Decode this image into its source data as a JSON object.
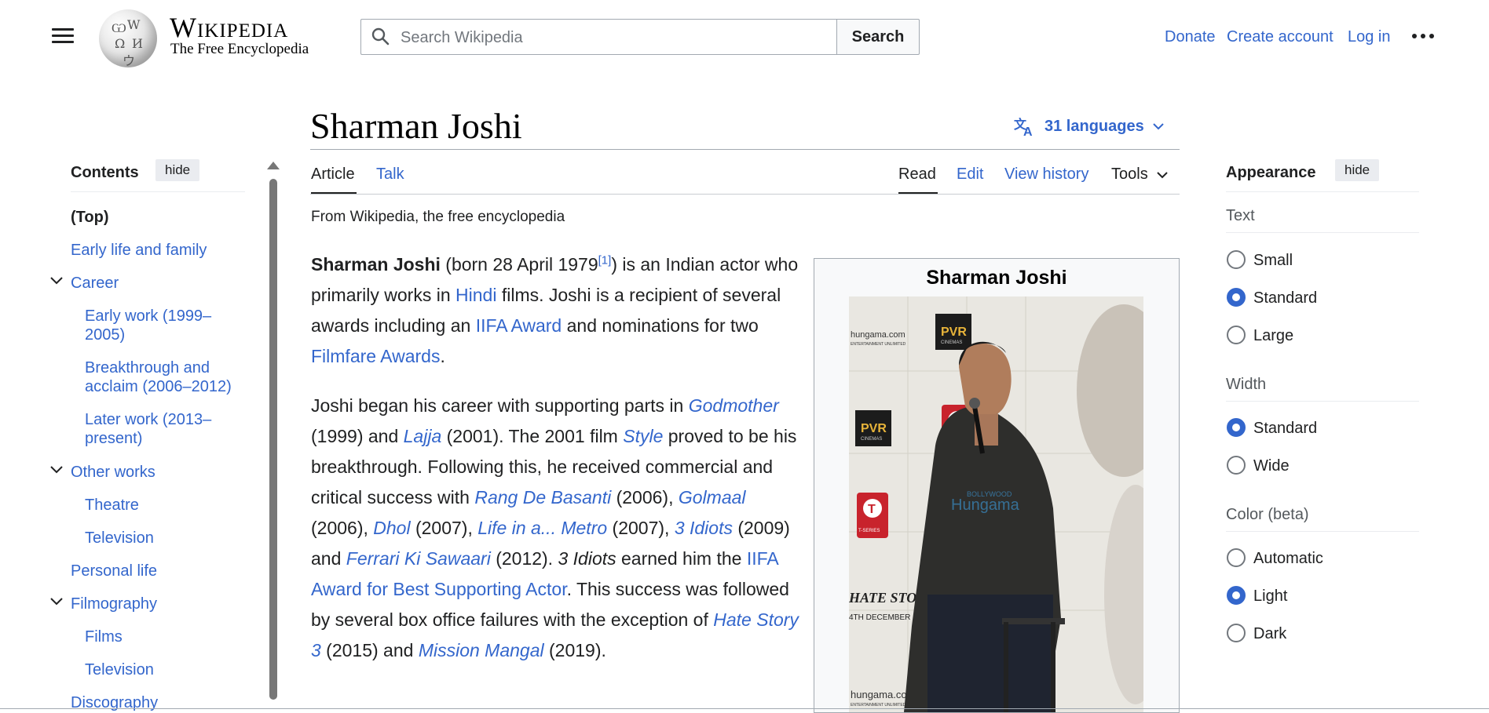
{
  "header": {
    "wordmark": "Wikipedia",
    "tagline": "The Free Encyclopedia",
    "search_placeholder": "Search Wikipedia",
    "search_button": "Search",
    "links": {
      "donate": "Donate",
      "create_account": "Create account",
      "log_in": "Log in"
    },
    "icons": {
      "menu": "hamburger-menu-icon",
      "search": "search-icon",
      "more": "ellipsis-icon",
      "logo": "wikipedia-globe-logo"
    }
  },
  "page": {
    "title": "Sharman Joshi",
    "languages": "31 languages",
    "tabs": {
      "article": "Article",
      "talk": "Talk",
      "read": "Read",
      "edit": "Edit",
      "history": "View history",
      "tools": "Tools"
    },
    "from": "From Wikipedia, the free encyclopedia"
  },
  "article": {
    "p1": {
      "subject": "Sharman Joshi",
      "t1": " (born 28 April 1979",
      "ref": "[1]",
      "t2": ") is an Indian actor who primarily works in ",
      "l1": "Hindi",
      "t3": " films. Joshi is a recipient of several awards including an ",
      "l2": "IIFA Award",
      "t4": " and nominations for two ",
      "l3": "Filmfare Awards",
      "t5": "."
    },
    "p2": {
      "t1": "Joshi began his career with supporting parts in ",
      "f1": "Godmother",
      "t2": " (1999) and ",
      "f2": "Lajja",
      "t3": " (2001). The 2001 film ",
      "f3": "Style",
      "t4": " proved to be his breakthrough. Following this, he received commercial and critical success with ",
      "f4": "Rang De Basanti",
      "t5": " (2006), ",
      "f5": "Golmaal",
      "t6": " (2006), ",
      "f6": "Dhol",
      "t7": " (2007), ",
      "f7": "Life in a... Metro",
      "t8": " (2007), ",
      "f8": "3 Idiots",
      "t9": " (2009) and ",
      "f9": "Ferrari Ki Sawaari",
      "t10": " (2012). ",
      "f10": "3 Idiots",
      "t11": " earned him the ",
      "l1": "IIFA Award for Best Supporting Actor",
      "t12": ". This success was followed by several box office failures with the exception of ",
      "f11": "Hate Story 3",
      "t13": " (2015) and ",
      "f12": "Mission Mangal",
      "t14": " (2019)."
    }
  },
  "infobox": {
    "title": "Sharman Joshi",
    "image_text": {
      "hungama": "hungama.com",
      "hungama_sub": "ENTERTAINMENT UNLIMITED",
      "pvr": "PVR",
      "pvr_sub": "CINEMAS",
      "tseries": "T-SERIES",
      "tseries_sub": "FILMS",
      "hate": "HATE STORY",
      "dec": "4TH DECEMBER",
      "bollywood": "BOLLYWOOD",
      "hungama_wm": "Hungama"
    }
  },
  "toc": {
    "title": "Contents",
    "hide": "hide",
    "items": {
      "top": "(Top)",
      "early": "Early life and family",
      "career": "Career",
      "early_work": "Early work (1999–2005)",
      "breakthrough": "Breakthrough and acclaim (2006–2012)",
      "later": "Later work (2013–present)",
      "other": "Other works",
      "theatre": "Theatre",
      "television": "Television",
      "personal": "Personal life",
      "filmography": "Filmography",
      "films": "Films",
      "television2": "Television",
      "discography": "Discography"
    }
  },
  "appearance": {
    "title": "Appearance",
    "hide": "hide",
    "text": {
      "label": "Text",
      "small": "Small",
      "standard": "Standard",
      "large": "Large",
      "selected": "Standard"
    },
    "width": {
      "label": "Width",
      "standard": "Standard",
      "wide": "Wide",
      "selected": "Standard"
    },
    "color": {
      "label": "Color (beta)",
      "automatic": "Automatic",
      "light": "Light",
      "dark": "Dark",
      "selected": "Light"
    }
  },
  "colors": {
    "link": "#3366cc",
    "text": "#202122",
    "border": "#a2a9b1"
  }
}
